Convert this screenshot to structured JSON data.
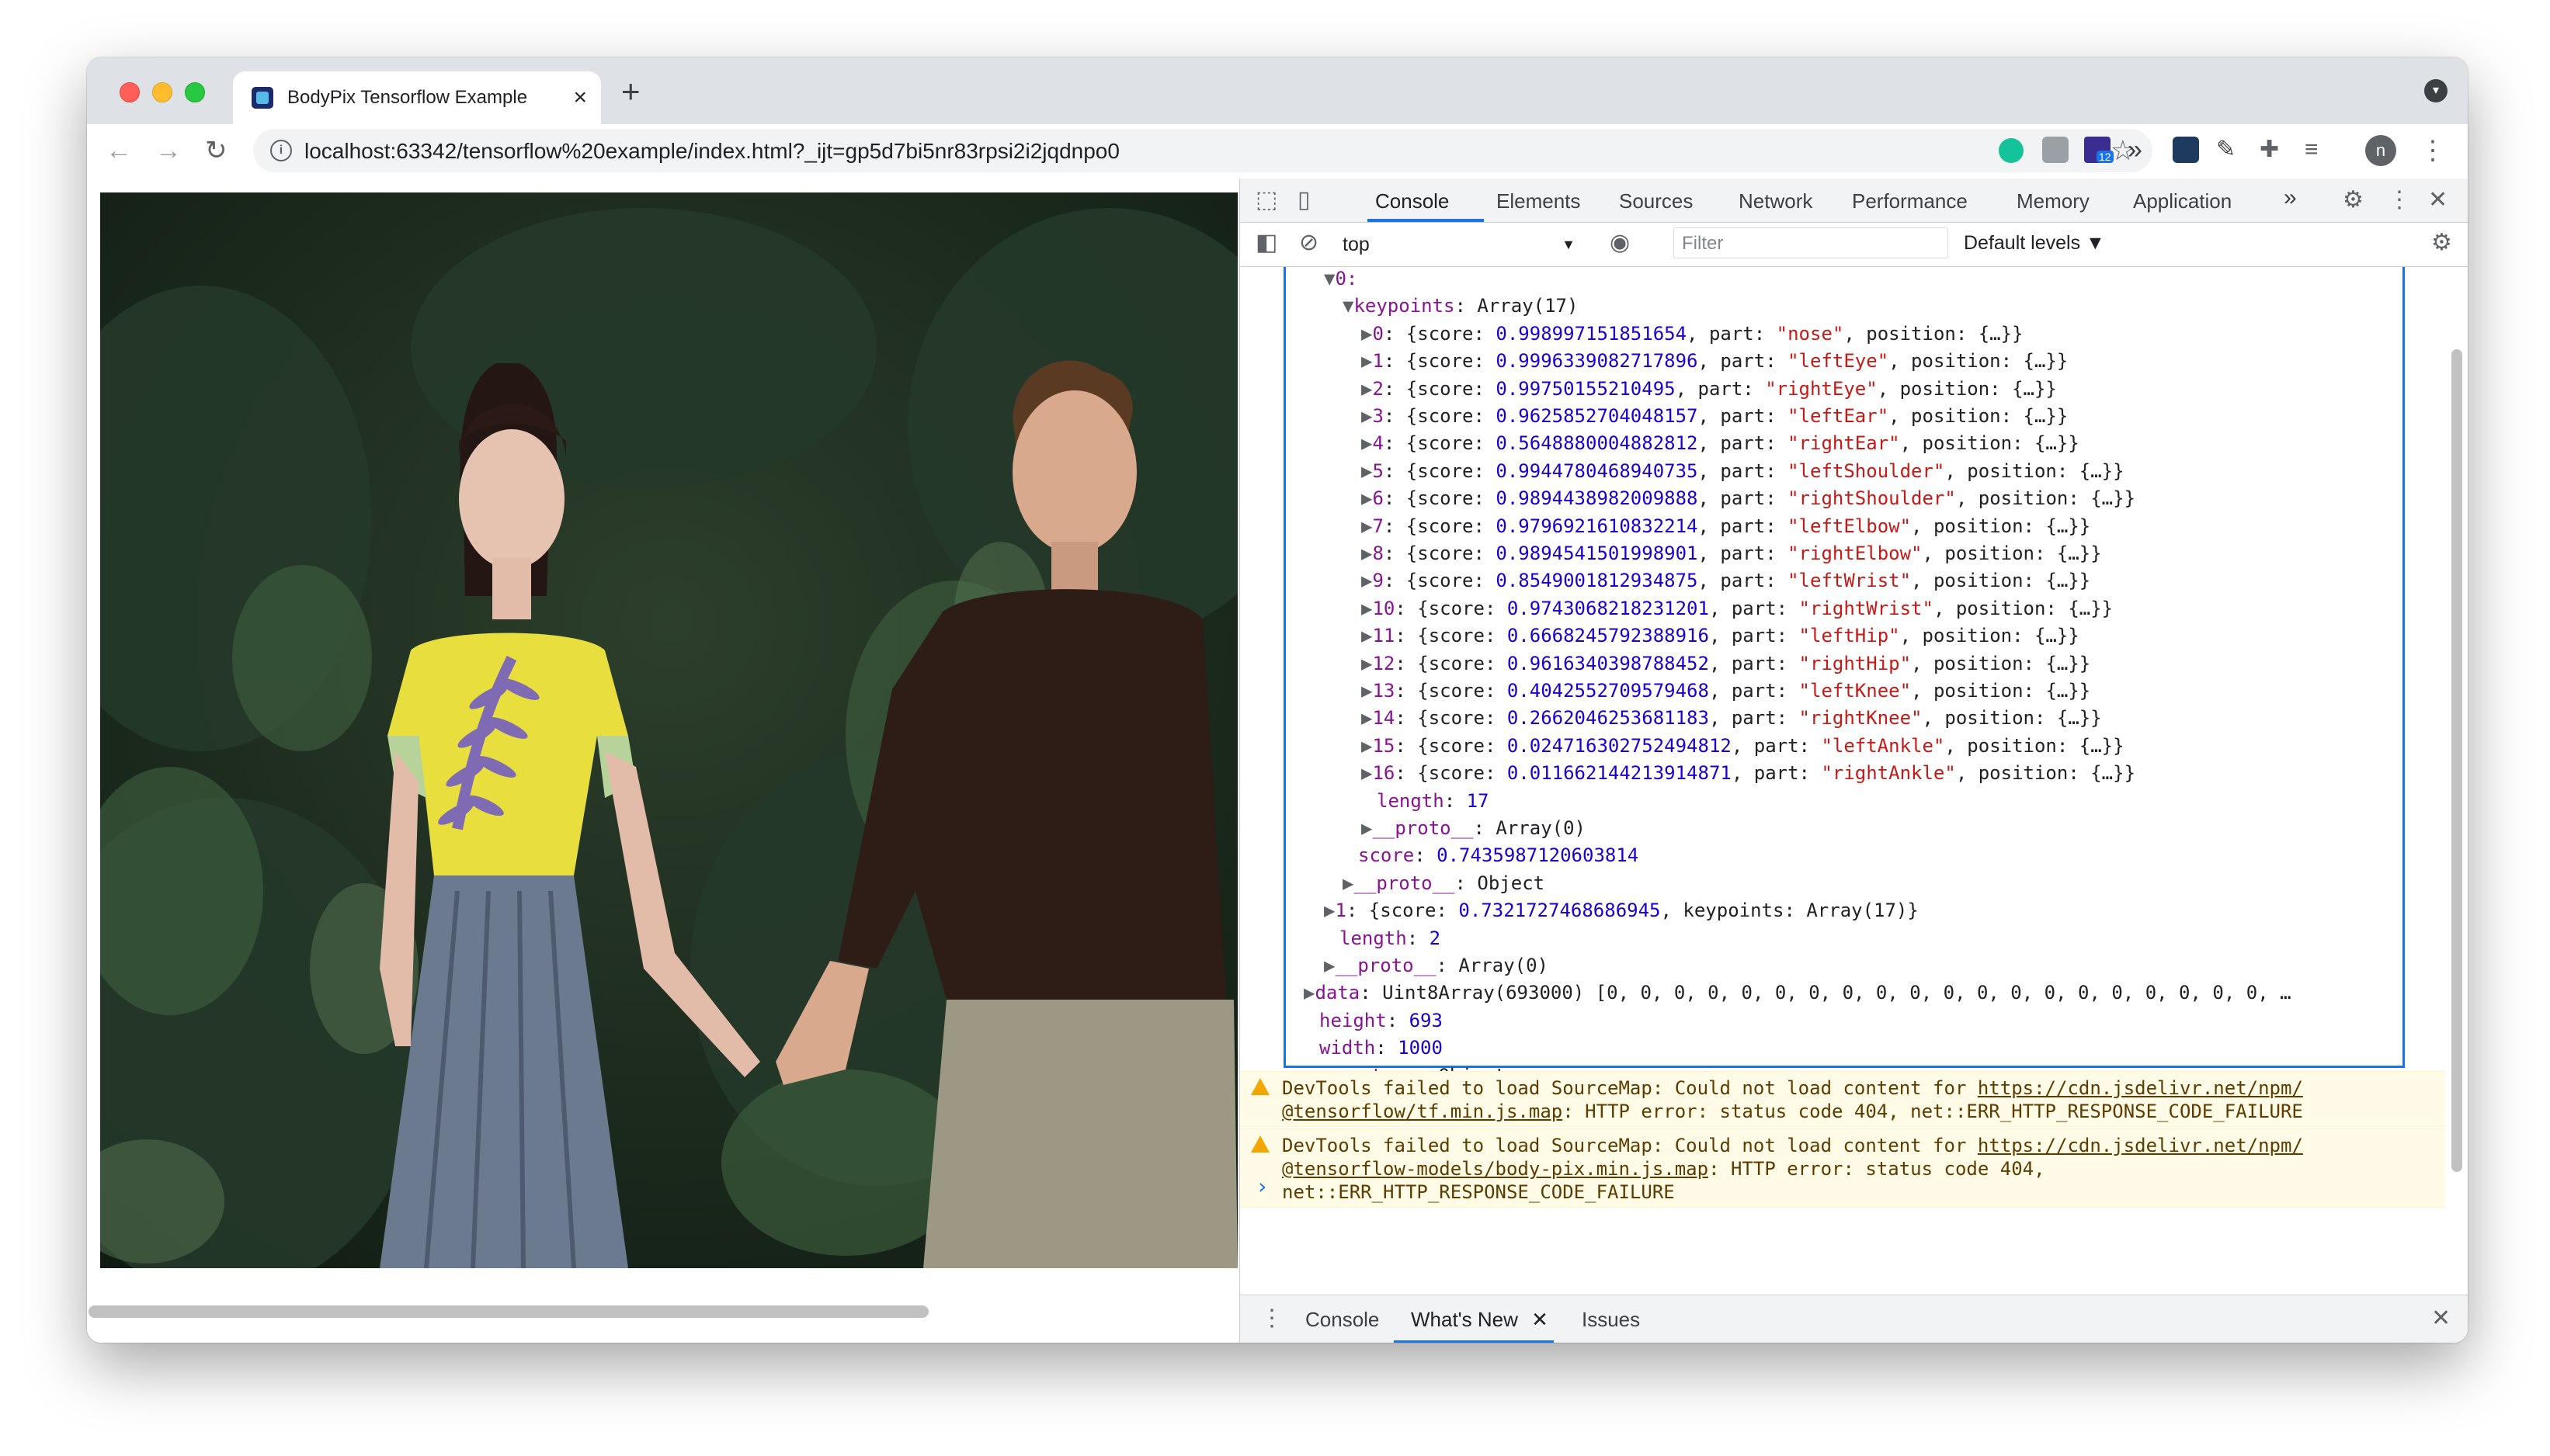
{
  "browser": {
    "tab_title": "BodyPix Tensorflow Example",
    "tab_close": "×",
    "new_tab": "+",
    "url": "localhost:63342/tensorflow%20example/index.html?_ijt=gp5d7bi5nr83rpsi2i2jqdnpo0",
    "avatar_letter": "n",
    "extension_badge": "12"
  },
  "devtools": {
    "tabs": [
      "Console",
      "Elements",
      "Sources",
      "Network",
      "Performance",
      "Memory",
      "Application"
    ],
    "more_tabs": "»",
    "context": "top",
    "filter_placeholder": "Filter",
    "levels": "Default levels ▼",
    "drawer_tabs": [
      "Console",
      "What's New",
      "Issues"
    ]
  },
  "console": {
    "head": "0:",
    "keypoints_label": "keypoints",
    "keypoints_type": "Array(17)",
    "keypoints": [
      {
        "i": "0",
        "score": "0.998997151851654",
        "part": "\"nose\""
      },
      {
        "i": "1",
        "score": "0.9996339082717896",
        "part": "\"leftEye\""
      },
      {
        "i": "2",
        "score": "0.99750155210495",
        "part": "\"rightEye\""
      },
      {
        "i": "3",
        "score": "0.9625852704048157",
        "part": "\"leftEar\""
      },
      {
        "i": "4",
        "score": "0.5648880004882812",
        "part": "\"rightEar\""
      },
      {
        "i": "5",
        "score": "0.9944780468940735",
        "part": "\"leftShoulder\""
      },
      {
        "i": "6",
        "score": "0.9894438982009888",
        "part": "\"rightShoulder\""
      },
      {
        "i": "7",
        "score": "0.9796921610832214",
        "part": "\"leftElbow\""
      },
      {
        "i": "8",
        "score": "0.9894541501998901",
        "part": "\"rightElbow\""
      },
      {
        "i": "9",
        "score": "0.8549001812934875",
        "part": "\"leftWrist\""
      },
      {
        "i": "10",
        "score": "0.9743068218231201",
        "part": "\"rightWrist\""
      },
      {
        "i": "11",
        "score": "0.6668245792388916",
        "part": "\"leftHip\""
      },
      {
        "i": "12",
        "score": "0.9616340398788452",
        "part": "\"rightHip\""
      },
      {
        "i": "13",
        "score": "0.4042552709579468",
        "part": "\"leftKnee\""
      },
      {
        "i": "14",
        "score": "0.2662046253681183",
        "part": "\"rightKnee\""
      },
      {
        "i": "15",
        "score": "0.024716302752494812",
        "part": "\"leftAnkle\""
      },
      {
        "i": "16",
        "score": "0.011662144213914871",
        "part": "\"rightAnkle\""
      }
    ],
    "kp_length": "17",
    "kp_proto": "Array(0)",
    "pose_score": "0.7435987120603814",
    "pose_proto": "Object",
    "pose1_score": "0.7321727468686945",
    "pose1_keypoints": "Array(17)",
    "poses_length": "2",
    "poses_proto": "Array(0)",
    "data_type": "Uint8Array(693000)",
    "data_preview": "[0, 0, 0, 0, 0, 0, 0, 0, 0, 0, 0, 0, 0, 0, 0, 0, 0, 0, 0, 0, …",
    "height": "693",
    "width": "1000",
    "root_proto": "Object",
    "warnings": [
      {
        "prefix": "DevTools failed to load SourceMap: Could not load content for ",
        "link1": "https://cdn.jsdelivr.net/npm/",
        "link2": "@tensorflow/tf.min.js.map",
        "suffix": ": HTTP error: status code 404, net::ERR_HTTP_RESPONSE_CODE_FAILURE"
      },
      {
        "prefix": "DevTools failed to load SourceMap: Could not load content for ",
        "link1": "https://cdn.jsdelivr.net/npm/",
        "link2": "@tensorflow-models/body-pix.min.js.map",
        "suffix": ": HTTP error: status code 404,",
        "suffix2": "net::ERR_HTTP_RESPONSE_CODE_FAILURE"
      }
    ]
  }
}
